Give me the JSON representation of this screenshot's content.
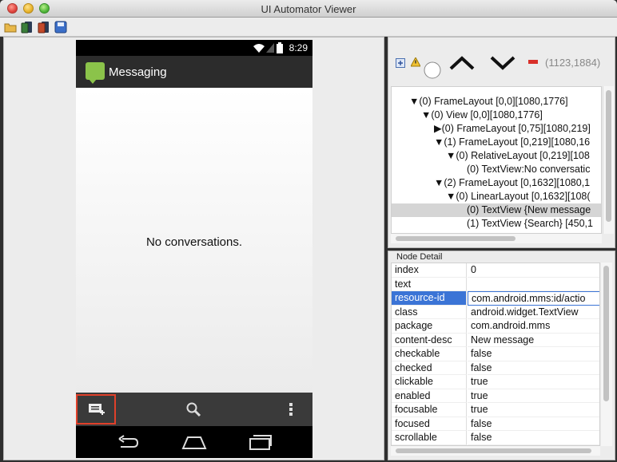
{
  "window": {
    "title": "UI Automator Viewer"
  },
  "device": {
    "status_time": "8:29",
    "app_title": "Messaging",
    "empty_message": "No conversations."
  },
  "hierarchy": {
    "coords": "(1123,1884)",
    "rows": [
      "▼(0) FrameLayout [0,0][1080,1776]",
      "▼(0) View [0,0][1080,1776]",
      "▶(0) FrameLayout [0,75][1080,219]",
      "▼(1) FrameLayout [0,219][1080,16",
      "▼(0) RelativeLayout [0,219][108",
      "(0) TextView:No conversatic",
      "▼(2) FrameLayout [0,1632][1080,1",
      "▼(0) LinearLayout [0,1632][108(",
      "(0) TextView {New message",
      "(1) TextView {Search} [450,1"
    ]
  },
  "node_detail": {
    "title": "Node Detail",
    "rows": [
      {
        "key": "index",
        "value": "0"
      },
      {
        "key": "text",
        "value": ""
      },
      {
        "key": "resource-id",
        "value": "com.android.mms:id/actio"
      },
      {
        "key": "class",
        "value": "android.widget.TextView"
      },
      {
        "key": "package",
        "value": "com.android.mms"
      },
      {
        "key": "content-desc",
        "value": "New message"
      },
      {
        "key": "checkable",
        "value": "false"
      },
      {
        "key": "checked",
        "value": "false"
      },
      {
        "key": "clickable",
        "value": "true"
      },
      {
        "key": "enabled",
        "value": "true"
      },
      {
        "key": "focusable",
        "value": "true"
      },
      {
        "key": "focused",
        "value": "false"
      },
      {
        "key": "scrollable",
        "value": "false"
      }
    ]
  },
  "colors": {
    "selection": "#3b74d6",
    "highlight_box": "#e0402a",
    "app_icon": "#8bc34a"
  }
}
